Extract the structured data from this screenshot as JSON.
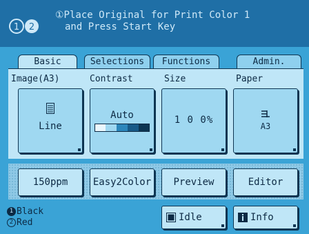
{
  "header": {
    "message_line1": "①Place Original for Print Color 1",
    "message_line2": "and Press Start Key"
  },
  "tabs": [
    {
      "label": "Basic",
      "active": true
    },
    {
      "label": "Selections",
      "active": false
    },
    {
      "label": "Functions",
      "active": false
    },
    {
      "label": "Admin.",
      "active": false
    }
  ],
  "columns": {
    "image": {
      "label": "Image(A3)",
      "value": "Line",
      "icon": "document-icon"
    },
    "contrast": {
      "label": "Contrast",
      "value": "Auto",
      "icon": "contrast-level-icon"
    },
    "size": {
      "label": "Size",
      "value": "1 0 0%"
    },
    "paper": {
      "label": "Paper",
      "value": "A3",
      "icon": "paper-stack-icon"
    }
  },
  "actions": [
    "150ppm",
    "Easy2Color",
    "Preview",
    "Editor"
  ],
  "status": {
    "ink1_num": "1",
    "ink1": "Black",
    "ink2_num": "2",
    "ink2": "Red",
    "idle_label": "Idle",
    "info_label": "Info"
  },
  "colors": {
    "background": "#3aa3d6",
    "header": "#1f6fa6",
    "panel": "#bfe6f7",
    "button": "#9fd8f1",
    "dark": "#0d3552"
  }
}
